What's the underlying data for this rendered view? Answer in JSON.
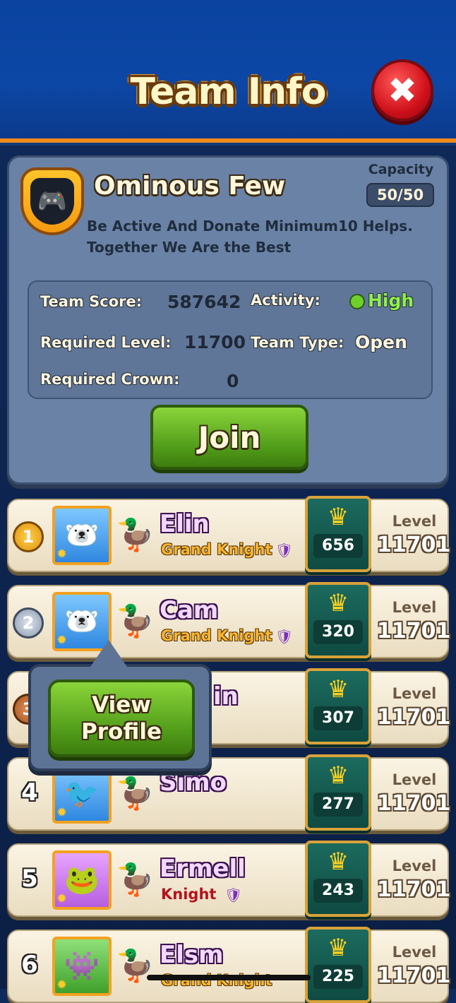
{
  "header": {
    "title": "Team Info",
    "close_icon": "✖"
  },
  "team": {
    "name": "Ominous Few",
    "description": "Be Active And Donate Minimum10 Helps. Together We Are the Best",
    "capacity_label": "Capacity",
    "capacity_value": "50/50",
    "stats": {
      "score_label": "Team Score:",
      "score_value": "587642",
      "activity_label": "Activity:",
      "activity_value": "High",
      "level_label": "Required Level:",
      "level_value": "11700",
      "type_label": "Team Type:",
      "type_value": "Open",
      "crown_label": "Required Crown:",
      "crown_value": "0"
    },
    "join_label": "Join"
  },
  "members": [
    {
      "rank": "1",
      "name": "Elin",
      "role": "Grand Knight",
      "crowns": "656",
      "level_label": "Level",
      "level": "11701"
    },
    {
      "rank": "2",
      "name": "Cam",
      "role": "Grand Knight",
      "crowns": "320",
      "level_label": "Level",
      "level": "11701"
    },
    {
      "rank": "3",
      "name": "in",
      "role": "",
      "crowns": "307",
      "level_label": "Level",
      "level": "11701"
    },
    {
      "rank": "4",
      "name": "Simo",
      "role": "",
      "crowns": "277",
      "level_label": "Level",
      "level": "11701"
    },
    {
      "rank": "5",
      "name": "Ermell",
      "role": "Knight",
      "crowns": "243",
      "level_label": "Level",
      "level": "11701"
    },
    {
      "rank": "6",
      "name": "Elsm",
      "role": "Grand Knight",
      "crowns": "225",
      "level_label": "Level",
      "level": "11701"
    }
  ],
  "popup": {
    "button_label": "View\nProfile"
  },
  "colors": {
    "accent_orange": "#f08a1c",
    "join_green": "#4f9a18",
    "panel": "#6a82a6",
    "activity_high": "#6ed12b"
  }
}
